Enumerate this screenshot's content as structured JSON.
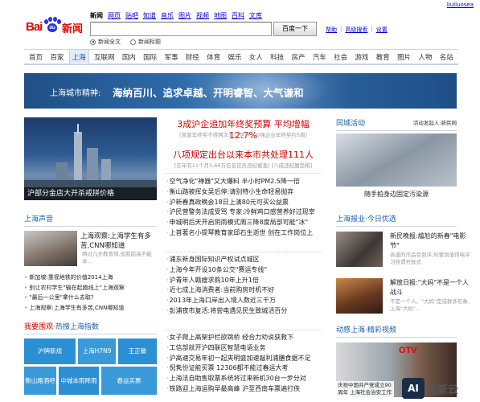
{
  "header": {
    "user": "liuliuosea",
    "logo_text_1": "Bai",
    "logo_text_2": "du",
    "logo_text_3": "新闻",
    "nav": [
      "新闻",
      "网页",
      "贴吧",
      "知道",
      "音乐",
      "图片",
      "视频",
      "地图",
      "百科",
      "文库"
    ],
    "search_value": "",
    "search_button": "百度一下",
    "links": [
      "帮助",
      "高级搜索",
      "设置"
    ],
    "radio_full": "新闻全文",
    "radio_title": "新闻标题"
  },
  "channels": [
    "首页",
    "百家",
    "上海",
    "互联网",
    "国内",
    "国际",
    "军事",
    "财经",
    "体育",
    "娱乐",
    "女人",
    "科技",
    "房产",
    "汽车",
    "社会",
    "游戏",
    "教育",
    "图片",
    "人物",
    "名站"
  ],
  "banner": {
    "label": "上海城市精神:",
    "slogan": "海纳百川、追求卓越、开明睿智、大气谦和"
  },
  "left": {
    "main_caption": "沪部分金店大开杀戒拼价格",
    "voices_title": "上海声音",
    "observe_title": "上海观察:上海学生有多苦,CNN哪知道",
    "observe_summary": "两过几天教育部,但我前高不能本…",
    "list": [
      {
        "text": "新加坡:重视地铁的价值2014上海",
        "dot": false
      },
      {
        "text": "别让农村学生\"输在起跑线上\"上海观察",
        "dot": false
      },
      {
        "text": "\"最后一公里\"拿什么去取?",
        "dot": false
      },
      {
        "text": "上海观察:上海学生有多苦,CNN哪知道",
        "dot": false
      }
    ],
    "watch_label": "我要围观",
    "watch_dot": "·",
    "watch_hot": "热搜上海指数",
    "tiles": [
      "沪牌新规",
      "上海H7N9",
      "王正敏",
      "衡山路酒吧",
      "中城本雨降雨",
      "春运买票"
    ]
  },
  "center": {
    "headline1": "3成沪企追加年终奖预算 平均增幅12.7%",
    "sub1": "[凯恩年终奖不得两次发] [世界500强企业年终奖约5周]",
    "headline2": "八项规定出台以来本市共处理111人",
    "sub2": "[去年有11个月5,69万名名官员违纪被查] [八成违纪属受贿]",
    "group1": [
      "空气净化\"禅器\"又大爆料 半小时PM2.5降一倍",
      "衡山路被挥女吴后停:请别特小生命轻易抛弃",
      "沪新春真政晚会18日上演80元可买公益票",
      "沪民营警务法成受骂 专家:冷鲜鸡口感营养好过现宰",
      "申城明后天开启阴雨模式周三降8度局部可能\"冰\"",
      "上首著名小提琴教育家邱石生逝世 创在工作岗位上"
    ],
    "group2": [
      "浦东新身国际知识产权试点城区",
      "上海今年开设10条公交\"赛运专线\"",
      "沪青年人赣嫂求购10年上升1倍",
      "近七成上海消费者:当前购房时机不好",
      "2013年上海口岸出入境人数近三千万",
      "彭浦夜市复活:将尝电遇见民生致城活百分"
    ],
    "group3": [
      "女子爬上高架护栏欲跳桥 经合力劝说获救下",
      "工信部就开沪四联区智慧电语业务",
      "沪高速交易年初一起夹明盛加速敲利浦膳食据不足",
      "倪隽份证能买票 12306都不能过春运大考",
      "上海法自助售取票系统将过来新机30台一步分对",
      "铁路迎上海运购早最高峰 沪至西南车票遍打佚"
    ]
  },
  "right": {
    "same_city_title": "同城活动",
    "same_city_more": "活动发起人:新民网",
    "same_city_caption": "随手拍身边固定污染源",
    "paper_title": "上海报业·今日优选",
    "paper_items": [
      {
        "title": "新民晚报:尴尬的新春\"电影节\"",
        "text": "各道的作品受到评,所要到值得电学习所谓开放式"
      },
      {
        "title": "解放日报:\"大妈\"不是一个人战斗",
        "text": "不是一个人。\"大妈\"是成群多形象,上海\"大妈\"…"
      }
    ],
    "video_title": "动感上海·精彩视频",
    "video_caption": "庆祝中国共产党成立90周年 上海社会治安工作",
    "video_tag": "OTV"
  },
  "watermark": {
    "box": "AI",
    "text": "创新云"
  }
}
